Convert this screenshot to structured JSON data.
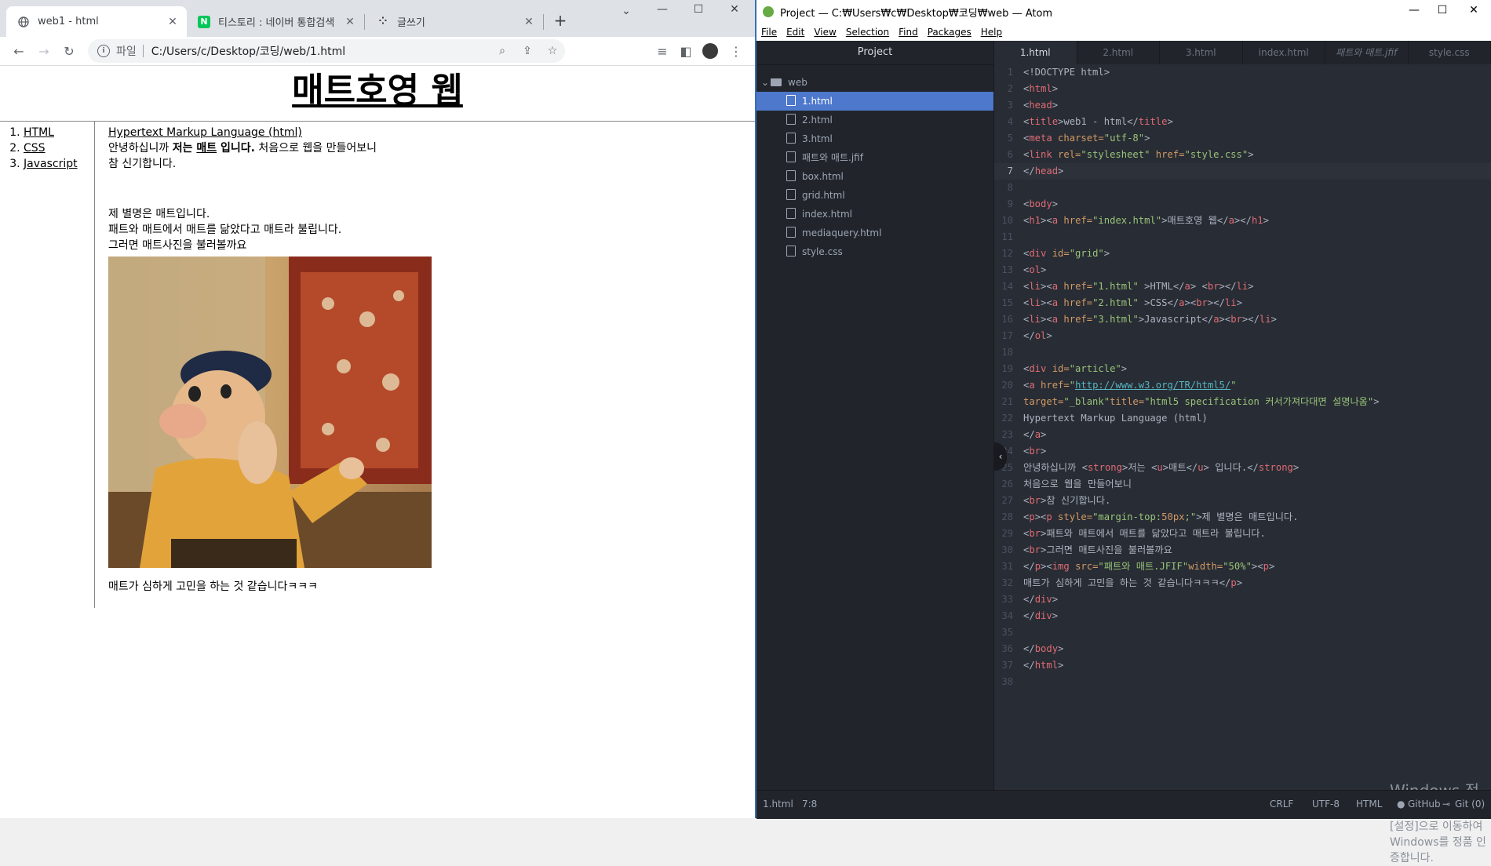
{
  "chrome": {
    "tabs": [
      {
        "title": "web1 - html",
        "icon": "globe-icon",
        "active": true
      },
      {
        "title": "티스토리 : 네이버 통합검색",
        "icon": "naver-icon",
        "active": false
      },
      {
        "title": "글쓰기",
        "icon": "tistory-icon",
        "active": false
      }
    ],
    "new_tab": "+",
    "toolbar": {
      "scheme": "파일",
      "url": "C:/Users/c/Desktop/코딩/web/1.html"
    },
    "page": {
      "heading": "매트호영 웹",
      "nav": [
        "HTML",
        "CSS",
        "Javascript"
      ],
      "article_link": "Hypertext Markup Language (html)",
      "intro_1": "안녕하십니까 ",
      "intro_strong_1": "저는 ",
      "intro_strong_u": "매트",
      "intro_strong_2": " 입니다.",
      "intro_2": " 처음으로 웹을 만들어보니",
      "intro_3": "참 신기합니다.",
      "para_1": "제 별명은 매트입니다.",
      "para_2": "패트와 매트에서 매트를 닮았다고 매트라 불립니다.",
      "para_3": "그러면 매트사진을 불러볼까요",
      "caption": "매트가 심하게 고민을 하는 것 같습니다ㅋㅋㅋ"
    }
  },
  "atom": {
    "title": "Project — C:₩Users₩c₩Desktop₩코딩₩web — Atom",
    "menu": [
      "File",
      "Edit",
      "View",
      "Selection",
      "Find",
      "Packages",
      "Help"
    ],
    "tree_header": "Project",
    "tree_folder": "web",
    "tree_files": [
      "1.html",
      "2.html",
      "3.html",
      "패트와 매트.jfif",
      "box.html",
      "grid.html",
      "index.html",
      "mediaquery.html",
      "style.css"
    ],
    "tabs": [
      "1.html",
      "2.html",
      "3.html",
      "index.html",
      "패트와 매트.jfif",
      "style.css"
    ],
    "code_lines": [
      [
        [
          "<!DOCTYPE html>",
          "#abb2bf"
        ]
      ],
      [
        [
          "<",
          "#abb2bf"
        ],
        [
          "html",
          "#e06c75"
        ],
        [
          ">",
          "#abb2bf"
        ]
      ],
      [
        [
          "<",
          "#abb2bf"
        ],
        [
          "head",
          "#e06c75"
        ],
        [
          ">",
          "#abb2bf"
        ]
      ],
      [
        [
          "<",
          "#abb2bf"
        ],
        [
          "title",
          "#e06c75"
        ],
        [
          ">web1 - html</",
          "#abb2bf"
        ],
        [
          "title",
          "#e06c75"
        ],
        [
          ">",
          "#abb2bf"
        ]
      ],
      [
        [
          "<",
          "#abb2bf"
        ],
        [
          "meta",
          "#e06c75"
        ],
        [
          " charset=",
          "#d19a66"
        ],
        [
          "\"utf-8\"",
          "#98c379"
        ],
        [
          ">",
          "#abb2bf"
        ]
      ],
      [
        [
          "<",
          "#abb2bf"
        ],
        [
          "link",
          "#e06c75"
        ],
        [
          " rel=",
          "#d19a66"
        ],
        [
          "\"stylesheet\"",
          "#98c379"
        ],
        [
          " href=",
          "#d19a66"
        ],
        [
          "\"style.css\"",
          "#98c379"
        ],
        [
          ">",
          "#abb2bf"
        ]
      ],
      [
        [
          "</",
          "#abb2bf"
        ],
        [
          "head",
          "#e06c75"
        ],
        [
          ">",
          "#abb2bf"
        ]
      ],
      [],
      [
        [
          "<",
          "#abb2bf"
        ],
        [
          "body",
          "#e06c75"
        ],
        [
          ">",
          "#abb2bf"
        ]
      ],
      [
        [
          "<",
          "#abb2bf"
        ],
        [
          "h1",
          "#e06c75"
        ],
        [
          "><",
          "#abb2bf"
        ],
        [
          "a",
          "#e06c75"
        ],
        [
          " href=",
          "#d19a66"
        ],
        [
          "\"index.html\"",
          "#98c379"
        ],
        [
          ">매트호영 웹</",
          "#abb2bf"
        ],
        [
          "a",
          "#e06c75"
        ],
        [
          "></",
          "#abb2bf"
        ],
        [
          "h1",
          "#e06c75"
        ],
        [
          ">",
          "#abb2bf"
        ]
      ],
      [],
      [
        [
          "<",
          "#abb2bf"
        ],
        [
          "div",
          "#e06c75"
        ],
        [
          " id=",
          "#d19a66"
        ],
        [
          "\"grid\"",
          "#98c379"
        ],
        [
          ">",
          "#abb2bf"
        ]
      ],
      [
        [
          "<",
          "#abb2bf"
        ],
        [
          "ol",
          "#e06c75"
        ],
        [
          ">",
          "#abb2bf"
        ]
      ],
      [
        [
          "<",
          "#abb2bf"
        ],
        [
          "li",
          "#e06c75"
        ],
        [
          "><",
          "#abb2bf"
        ],
        [
          "a",
          "#e06c75"
        ],
        [
          " href=",
          "#d19a66"
        ],
        [
          "\"1.html\"",
          "#98c379"
        ],
        [
          " >HTML</",
          "#abb2bf"
        ],
        [
          "a",
          "#e06c75"
        ],
        [
          "> <",
          "#abb2bf"
        ],
        [
          "br",
          "#e06c75"
        ],
        [
          "></",
          "#abb2bf"
        ],
        [
          "li",
          "#e06c75"
        ],
        [
          ">",
          "#abb2bf"
        ]
      ],
      [
        [
          "<",
          "#abb2bf"
        ],
        [
          "li",
          "#e06c75"
        ],
        [
          "><",
          "#abb2bf"
        ],
        [
          "a",
          "#e06c75"
        ],
        [
          " href=",
          "#d19a66"
        ],
        [
          "\"2.html\"",
          "#98c379"
        ],
        [
          " >CSS</",
          "#abb2bf"
        ],
        [
          "a",
          "#e06c75"
        ],
        [
          "><",
          "#abb2bf"
        ],
        [
          "br",
          "#e06c75"
        ],
        [
          "></",
          "#abb2bf"
        ],
        [
          "li",
          "#e06c75"
        ],
        [
          ">",
          "#abb2bf"
        ]
      ],
      [
        [
          "<",
          "#abb2bf"
        ],
        [
          "li",
          "#e06c75"
        ],
        [
          "><",
          "#abb2bf"
        ],
        [
          "a",
          "#e06c75"
        ],
        [
          " href=",
          "#d19a66"
        ],
        [
          "\"3.html\"",
          "#98c379"
        ],
        [
          ">Javascript</",
          "#abb2bf"
        ],
        [
          "a",
          "#e06c75"
        ],
        [
          "><",
          "#abb2bf"
        ],
        [
          "br",
          "#e06c75"
        ],
        [
          "></",
          "#abb2bf"
        ],
        [
          "li",
          "#e06c75"
        ],
        [
          ">",
          "#abb2bf"
        ]
      ],
      [
        [
          "</",
          "#abb2bf"
        ],
        [
          "ol",
          "#e06c75"
        ],
        [
          ">",
          "#abb2bf"
        ]
      ],
      [],
      [
        [
          "<",
          "#abb2bf"
        ],
        [
          "div",
          "#e06c75"
        ],
        [
          " id=",
          "#d19a66"
        ],
        [
          "\"article\"",
          "#98c379"
        ],
        [
          ">",
          "#abb2bf"
        ]
      ],
      [
        [
          "<",
          "#abb2bf"
        ],
        [
          "a",
          "#e06c75"
        ],
        [
          " href=",
          "#d19a66"
        ],
        [
          "\"",
          "#98c379"
        ],
        [
          "http://www.w3.org/TR/html5/",
          "#56b6c2"
        ],
        [
          "\"",
          "#98c379"
        ]
      ],
      [
        [
          "target=",
          "#d19a66"
        ],
        [
          "\"_blank\"",
          "#98c379"
        ],
        [
          "title=",
          "#d19a66"
        ],
        [
          "\"html5 specification 커서가져다대면 설명나옴\"",
          "#98c379"
        ],
        [
          ">",
          "#abb2bf"
        ]
      ],
      [
        [
          "Hypertext Markup Language (html)",
          "#abb2bf"
        ]
      ],
      [
        [
          "</",
          "#abb2bf"
        ],
        [
          "a",
          "#e06c75"
        ],
        [
          ">",
          "#abb2bf"
        ]
      ],
      [
        [
          "<",
          "#abb2bf"
        ],
        [
          "br",
          "#e06c75"
        ],
        [
          ">",
          "#abb2bf"
        ]
      ],
      [
        [
          "안녕하십니까 <",
          "#abb2bf"
        ],
        [
          "strong",
          "#e06c75"
        ],
        [
          ">저는 <",
          "#abb2bf"
        ],
        [
          "u",
          "#e06c75"
        ],
        [
          ">매트</",
          "#abb2bf"
        ],
        [
          "u",
          "#e06c75"
        ],
        [
          "> 입니다.</",
          "#abb2bf"
        ],
        [
          "strong",
          "#e06c75"
        ],
        [
          ">",
          "#abb2bf"
        ]
      ],
      [
        [
          "처음으로 웹을 만들어보니",
          "#abb2bf"
        ]
      ],
      [
        [
          "<",
          "#abb2bf"
        ],
        [
          "br",
          "#e06c75"
        ],
        [
          ">참 신기합니다.",
          "#abb2bf"
        ]
      ],
      [
        [
          "<",
          "#abb2bf"
        ],
        [
          "p",
          "#e06c75"
        ],
        [
          "><",
          "#abb2bf"
        ],
        [
          "p",
          "#e06c75"
        ],
        [
          " style=",
          "#d19a66"
        ],
        [
          "\"margin-top:",
          "#98c379"
        ],
        [
          "50px",
          "#d19a66"
        ],
        [
          ";\"",
          "#98c379"
        ],
        [
          ">제 별명은 매트입니다.",
          "#abb2bf"
        ]
      ],
      [
        [
          "<",
          "#abb2bf"
        ],
        [
          "br",
          "#e06c75"
        ],
        [
          ">패트와 매트에서 매트를 닮았다고 매트라 불립니다.",
          "#abb2bf"
        ]
      ],
      [
        [
          "<",
          "#abb2bf"
        ],
        [
          "br",
          "#e06c75"
        ],
        [
          ">그러면 매트사진을 불러볼까요",
          "#abb2bf"
        ]
      ],
      [
        [
          "</",
          "#abb2bf"
        ],
        [
          "p",
          "#e06c75"
        ],
        [
          "><",
          "#abb2bf"
        ],
        [
          "img",
          "#e06c75"
        ],
        [
          " src=",
          "#d19a66"
        ],
        [
          "\"패트와 매트.JFIF\"",
          "#98c379"
        ],
        [
          "width=",
          "#d19a66"
        ],
        [
          "\"50%\"",
          "#98c379"
        ],
        [
          "><",
          "#abb2bf"
        ],
        [
          "p",
          "#e06c75"
        ],
        [
          ">",
          "#abb2bf"
        ]
      ],
      [
        [
          "매트가 심하게 고민을 하는 것 같습니다ㅋㅋㅋ</",
          "#abb2bf"
        ],
        [
          "p",
          "#e06c75"
        ],
        [
          ">",
          "#abb2bf"
        ]
      ],
      [
        [
          "</",
          "#abb2bf"
        ],
        [
          "div",
          "#e06c75"
        ],
        [
          ">",
          "#abb2bf"
        ]
      ],
      [
        [
          "</",
          "#abb2bf"
        ],
        [
          "div",
          "#e06c75"
        ],
        [
          ">",
          "#abb2bf"
        ]
      ],
      [],
      [
        [
          "</",
          "#abb2bf"
        ],
        [
          "body",
          "#e06c75"
        ],
        [
          ">",
          "#abb2bf"
        ]
      ],
      [
        [
          "</",
          "#abb2bf"
        ],
        [
          "html",
          "#e06c75"
        ],
        [
          ">",
          "#abb2bf"
        ]
      ],
      []
    ],
    "current_line": 7,
    "watermark_1": "Windows 정품 인증",
    "watermark_2": "[설정]으로 이동하여 Windows를 정품 인증합니다.",
    "status": {
      "file": "1.html",
      "cursor": "7:8",
      "line_ending": "CRLF",
      "encoding": "UTF-8",
      "grammar": "HTML",
      "github": "GitHub",
      "git": "Git (0)"
    }
  }
}
